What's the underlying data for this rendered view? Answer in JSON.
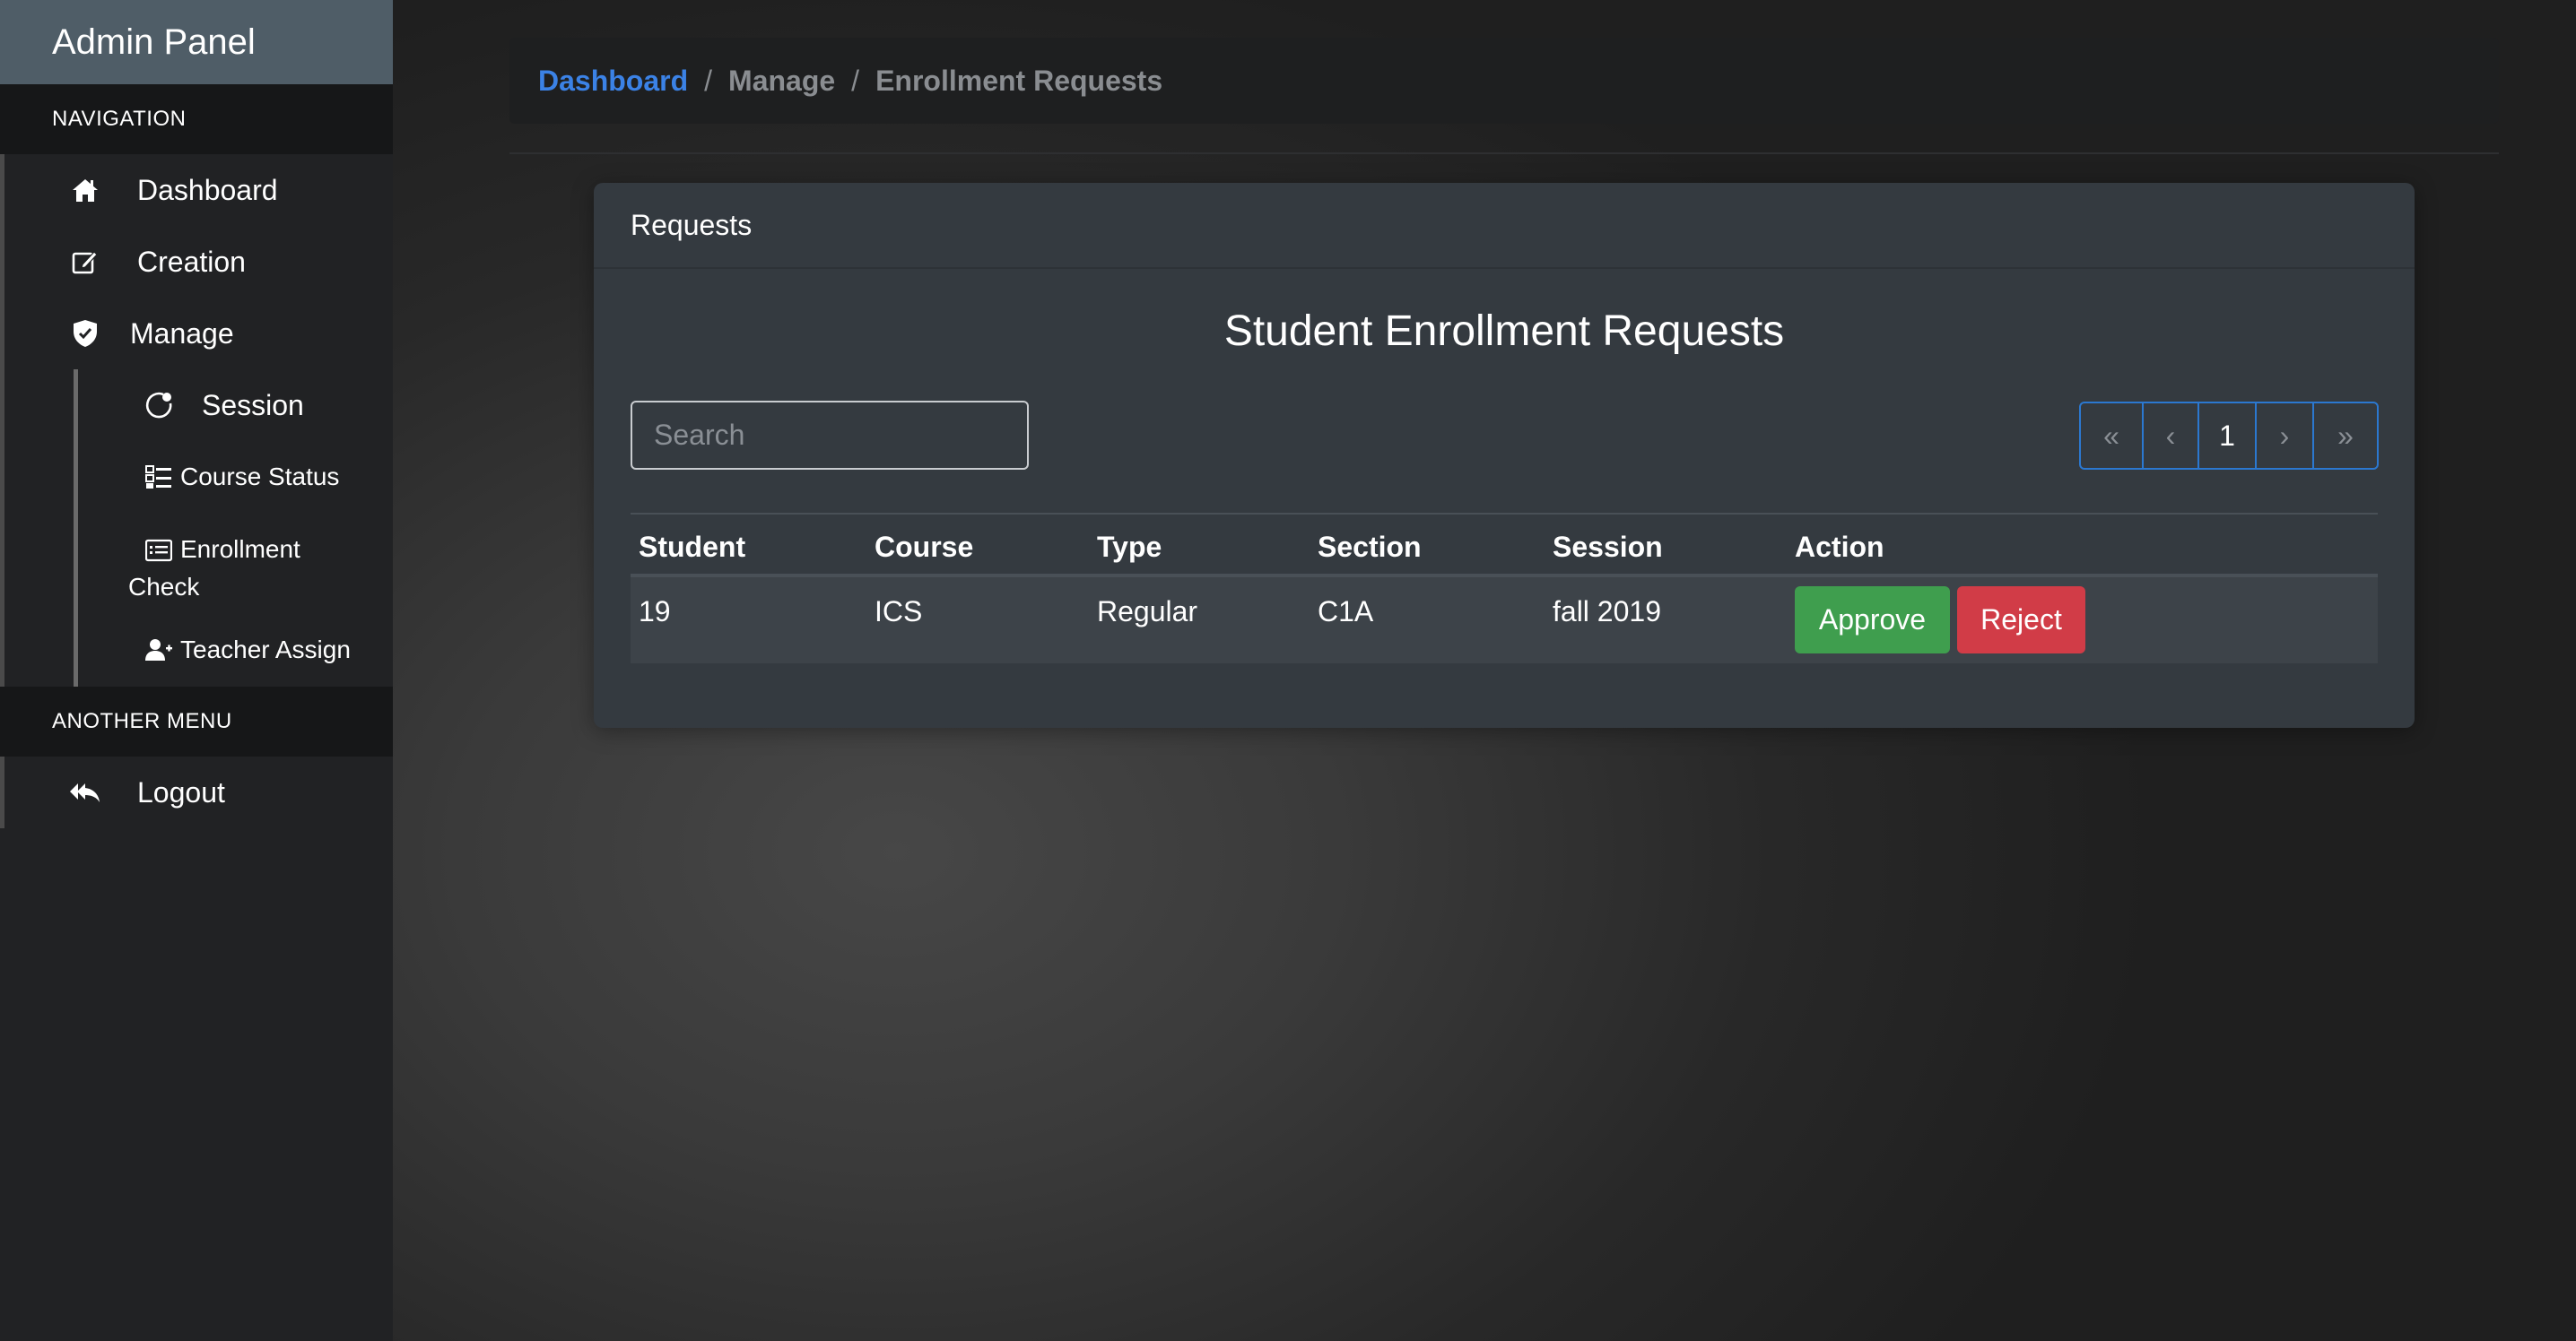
{
  "sidebar": {
    "brand": "Admin Panel",
    "nav_heading": "NAVIGATION",
    "items": [
      {
        "label": "Dashboard",
        "icon": "home-icon"
      },
      {
        "label": "Creation",
        "icon": "edit-icon"
      },
      {
        "label": "Manage",
        "icon": "shield-check-icon"
      }
    ],
    "sub_items": [
      {
        "label": "Session",
        "icon": "session-icon"
      },
      {
        "label": "Course Status",
        "icon": "list-check-icon"
      },
      {
        "label": "Enrollment",
        "label2": "Check",
        "icon": "card-list-icon"
      },
      {
        "label": "Teacher Assign",
        "icon": "user-add-icon"
      }
    ],
    "other_heading": "ANOTHER MENU",
    "logout": {
      "label": "Logout",
      "icon": "reply-all-icon"
    }
  },
  "breadcrumb": {
    "home": "Dashboard",
    "separator": "/",
    "middle": "Manage",
    "current": "Enrollment Requests"
  },
  "card": {
    "header": "Requests",
    "title": "Student Enrollment Requests",
    "search_placeholder": "Search"
  },
  "pagination": {
    "first": "«",
    "prev": "‹",
    "current": "1",
    "next": "›",
    "last": "»"
  },
  "table": {
    "columns": [
      "Student",
      "Course",
      "Type",
      "Section",
      "Session",
      "Action"
    ],
    "rows": [
      {
        "student": "19",
        "course": "ICS",
        "type": "Regular",
        "section": "C1A",
        "session": "fall 2019"
      }
    ],
    "approve_label": "Approve",
    "reject_label": "Reject"
  },
  "colors": {
    "brand_bar": "#4f5d67",
    "link": "#3b82e6",
    "approve": "#3f9e4e",
    "reject": "#d13c47",
    "pager_border": "#2b78d0"
  }
}
